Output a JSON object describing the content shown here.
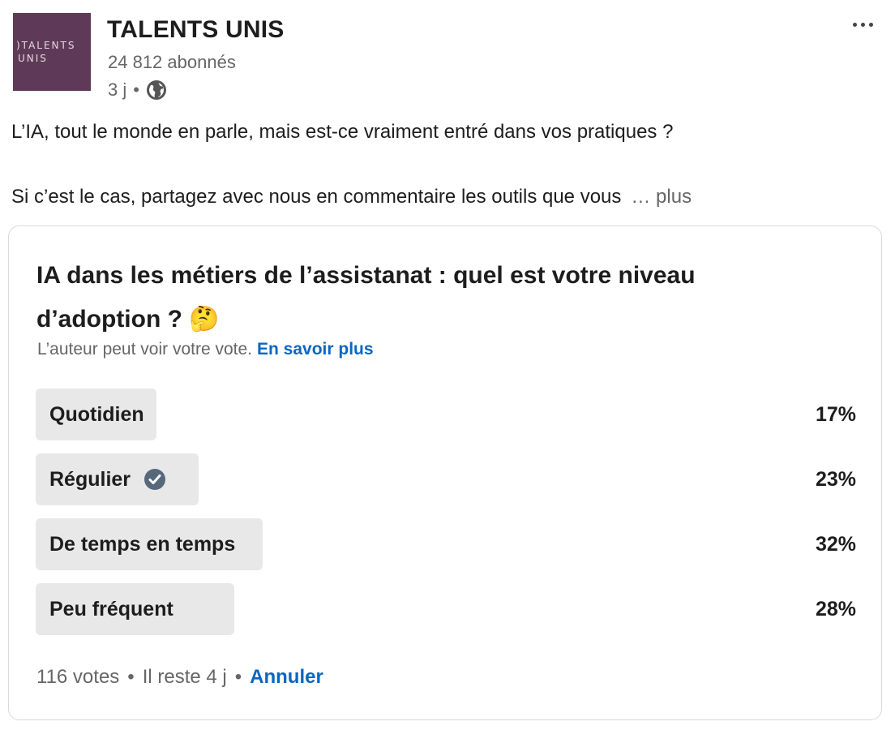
{
  "author": {
    "logo_line1": ")TALENTS",
    "logo_line2": "UNIS",
    "name": "TALENTS UNIS",
    "followers": "24 812 abonnés",
    "time": "3 j",
    "dot": "•",
    "visibility_icon": "globe-icon",
    "more_icon": "more-horizontal-icon"
  },
  "post": {
    "line1": "L’IA, tout le monde en parle, mais est-ce vraiment entré dans vos pratiques ?",
    "line2": "Si c’est le cas, partagez avec nous en commentaire les outils que vous",
    "see_more": "… plus"
  },
  "poll": {
    "question": "IA dans les métiers de l’assistanat : quel est votre niveau d’adoption ? 🤔",
    "note": "L’auteur peut voir votre vote.",
    "learn_more": "En savoir plus",
    "options": [
      {
        "label": "Quotidien",
        "percent_label": "17%",
        "percent": 17,
        "selected": false
      },
      {
        "label": "Régulier",
        "percent_label": "23%",
        "percent": 23,
        "selected": true
      },
      {
        "label": "De temps en temps",
        "percent_label": "32%",
        "percent": 32,
        "selected": false
      },
      {
        "label": "Peu fréquent",
        "percent_label": "28%",
        "percent": 28,
        "selected": false
      }
    ],
    "votes": "116 votes",
    "sep": "•",
    "remaining": "Il reste 4 j",
    "cancel": "Annuler"
  },
  "colors": {
    "accent": "#0a66c2",
    "logo_bg": "#5f3a58",
    "bar": "#e8e8e8",
    "check": "#56687a"
  }
}
